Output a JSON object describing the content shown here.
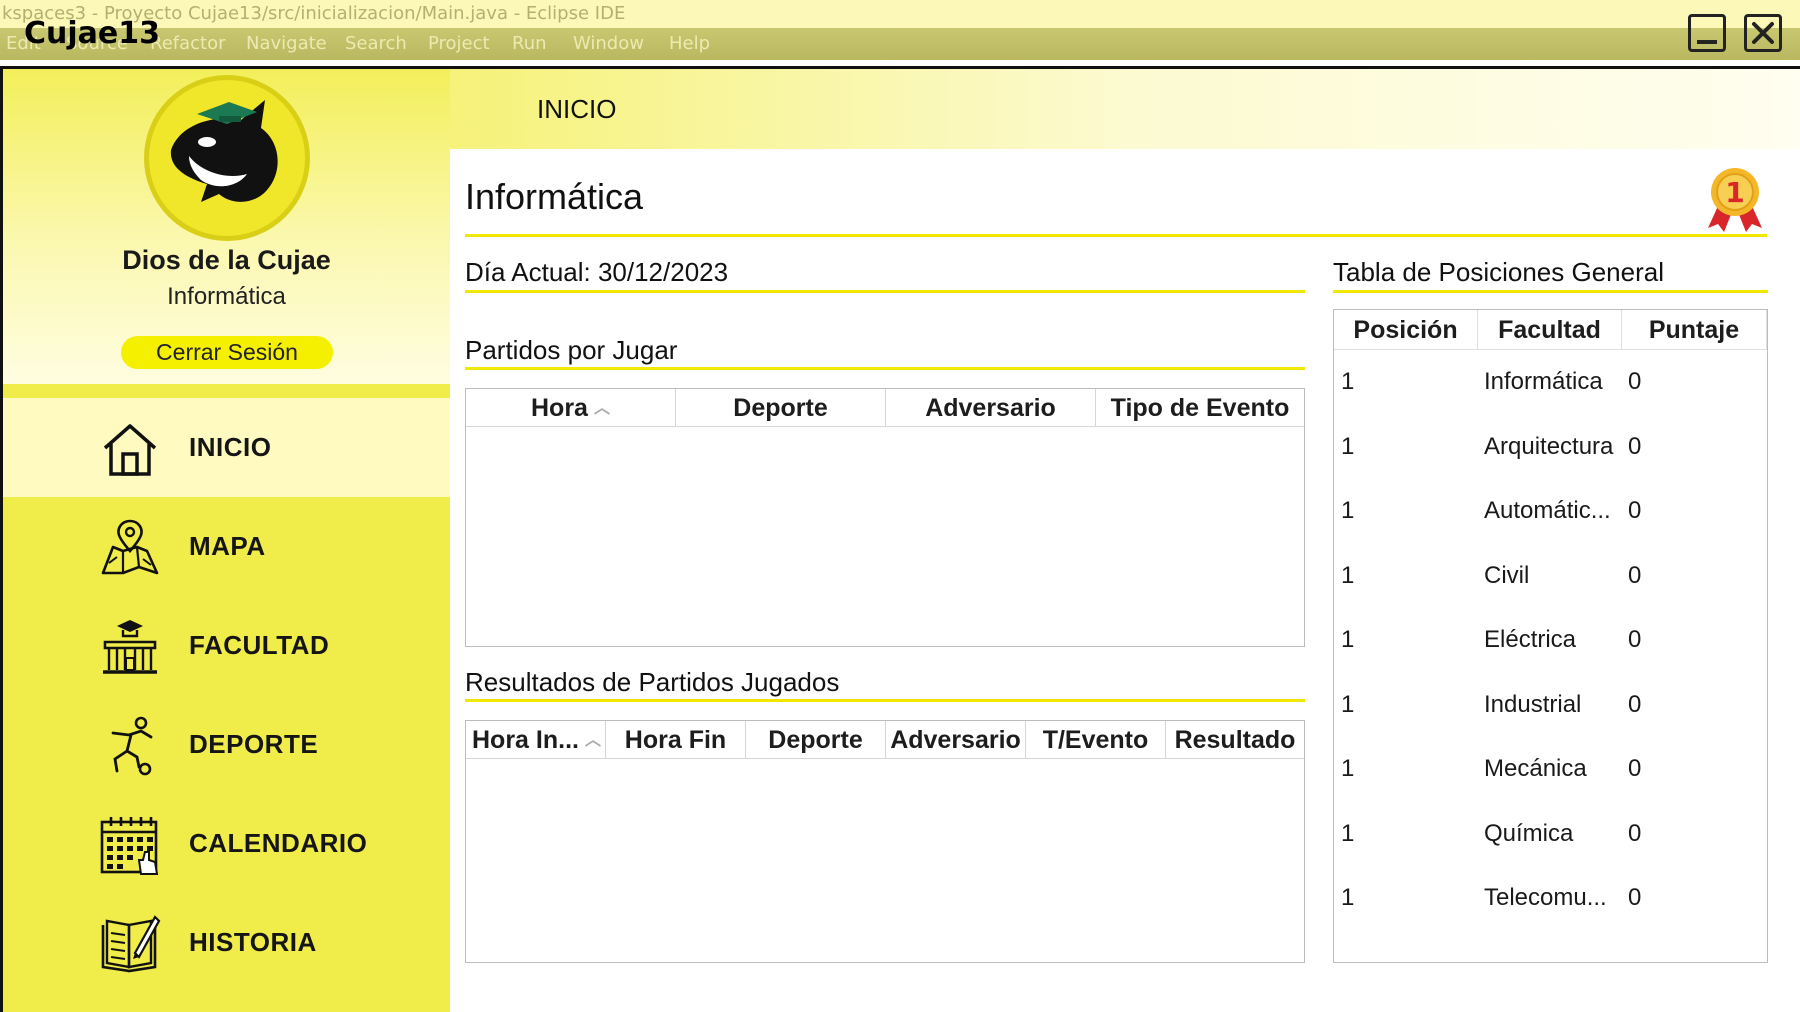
{
  "eclipse": {
    "title": "kspaces3 - Proyecto Cujae13/src/inicializacion/Main.java - Eclipse IDE",
    "menu": [
      "Edit",
      "Source",
      "Refactor",
      "Navigate",
      "Search",
      "Project",
      "Run",
      "Window",
      "Help"
    ]
  },
  "app": {
    "title": "Cujae13"
  },
  "profile": {
    "name": "Dios de la Cujae",
    "faculty": "Informática",
    "logout_label": "Cerrar Sesión"
  },
  "nav": {
    "items": [
      {
        "label": "INICIO",
        "icon": "home-icon",
        "active": true
      },
      {
        "label": "MAPA",
        "icon": "map-icon",
        "active": false
      },
      {
        "label": "FACULTAD",
        "icon": "building-icon",
        "active": false
      },
      {
        "label": "DEPORTE",
        "icon": "soccer-player-icon",
        "active": false
      },
      {
        "label": "CALENDARIO",
        "icon": "calendar-icon",
        "active": false
      },
      {
        "label": "HISTORIA",
        "icon": "book-icon",
        "active": false
      }
    ]
  },
  "header": {
    "title": "INICIO"
  },
  "main": {
    "faculty_title": "Informática",
    "current_day": "Día Actual: 30/12/2023",
    "upcoming": {
      "title": "Partidos por Jugar",
      "columns": [
        "Hora",
        "Deporte",
        "Adversario",
        "Tipo de Evento"
      ],
      "rows": []
    },
    "results": {
      "title": "Resultados de Partidos Jugados",
      "columns": [
        "Hora In...",
        "Hora Fin",
        "Deporte",
        "Adversario",
        "T/Evento",
        "Resultado"
      ],
      "rows": []
    },
    "standings": {
      "title": "Tabla de Posiciones General",
      "columns": [
        "Posición",
        "Facultad",
        "Puntaje"
      ],
      "rows": [
        {
          "pos": "1",
          "faculty": "Informática",
          "points": "0"
        },
        {
          "pos": "1",
          "faculty": "Arquitectura",
          "points": "0"
        },
        {
          "pos": "1",
          "faculty": "Automátic...",
          "points": "0"
        },
        {
          "pos": "1",
          "faculty": "Civil",
          "points": "0"
        },
        {
          "pos": "1",
          "faculty": "Eléctrica",
          "points": "0"
        },
        {
          "pos": "1",
          "faculty": "Industrial",
          "points": "0"
        },
        {
          "pos": "1",
          "faculty": "Mecánica",
          "points": "0"
        },
        {
          "pos": "1",
          "faculty": "Química",
          "points": "0"
        },
        {
          "pos": "1",
          "faculty": "Telecomu...",
          "points": "0"
        }
      ]
    },
    "medal_value": "1"
  },
  "colors": {
    "accent": "#f0ec4a",
    "highlight": "#f5f000",
    "rule": "#f0e800"
  }
}
